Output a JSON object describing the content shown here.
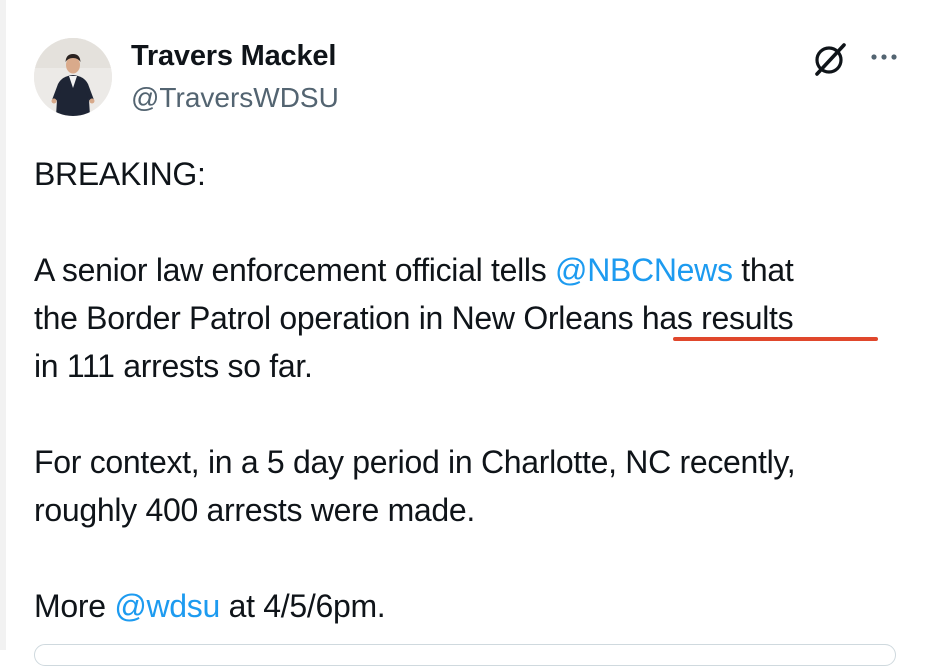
{
  "author": {
    "display_name": "Travers Mackel",
    "handle": "@TraversWDSU"
  },
  "header_icons": {
    "grok": "grok-icon",
    "more": "more-icon"
  },
  "tweet": {
    "line_breaking": "BREAKING:",
    "p2_a": "A senior law enforcement official tells ",
    "p2_mention": "@NBCNews",
    "p2_b": " that",
    "p2_c": "the Border Patrol operation in New Orleans has results",
    "p2_d": "in 111 arrests so far.",
    "p3_a": "For context, in a 5 day period in Charlotte, NC recently,",
    "p3_b": "roughly 400 arrests were made.",
    "p4_a": "More ",
    "p4_mention": "@wdsu",
    "p4_b": " at 4/5/6pm."
  },
  "colors": {
    "mention": "#1d9bf0",
    "handle": "#536471",
    "annotation_underline": "#e0472c"
  }
}
